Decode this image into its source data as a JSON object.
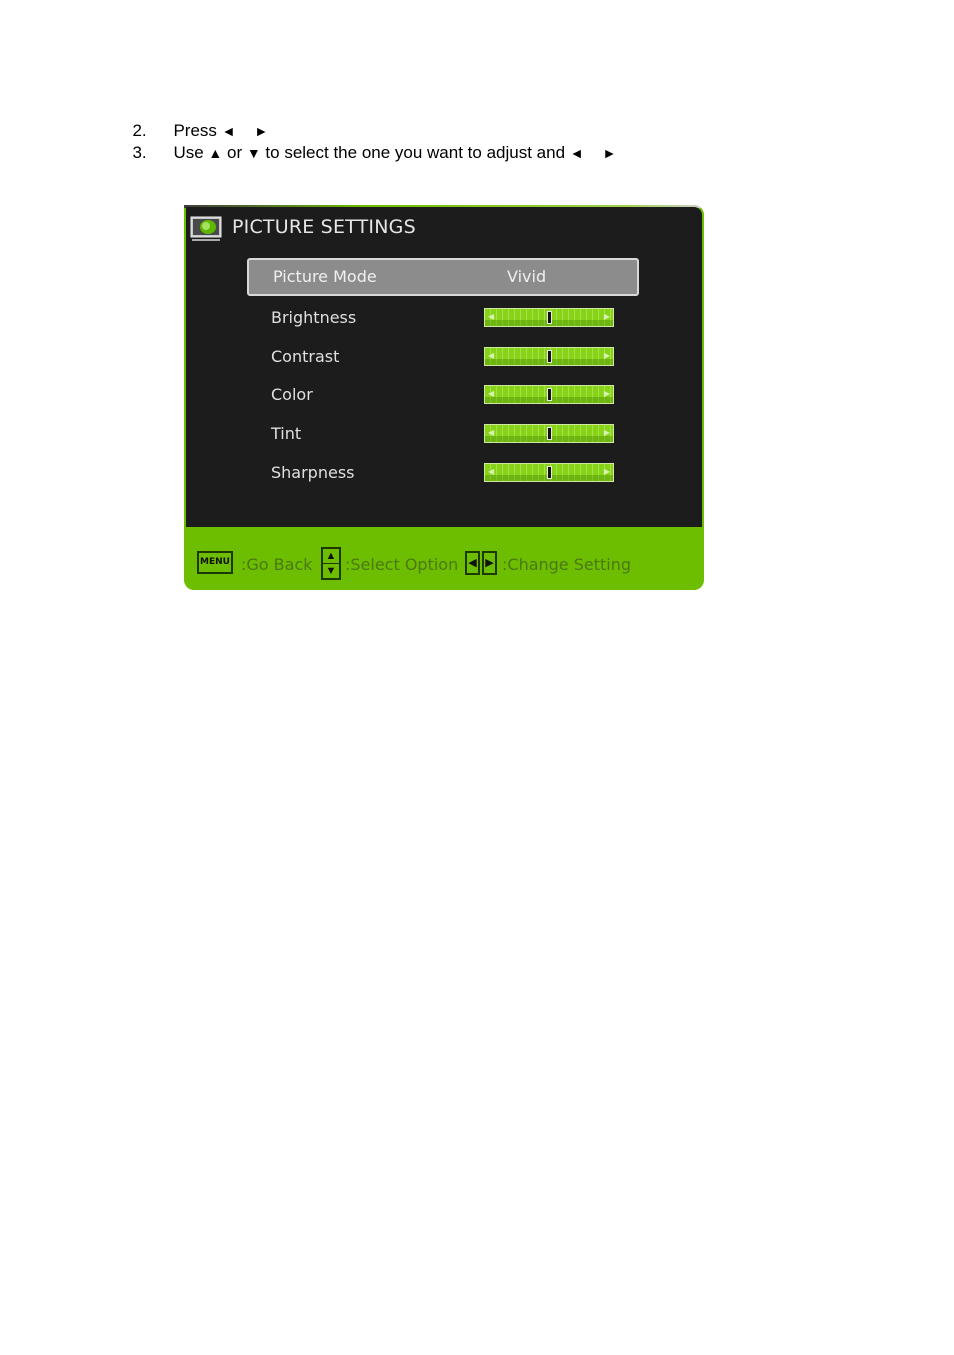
{
  "instructions": {
    "steps": [
      {
        "number": "2.",
        "text_before": "Press ",
        "arrow_left": "◄",
        "gap": "    ",
        "arrow_right": "►",
        "text_after": ""
      },
      {
        "number": "3.",
        "text_before": "Use ",
        "arrow_up": "▲",
        "mid1": " or ",
        "arrow_down": "▼",
        "mid2": " to select the one you want to adjust and ",
        "arrow_left": "◄",
        "gap": "    ",
        "arrow_right": "►"
      }
    ]
  },
  "osd": {
    "title": "PICTURE SETTINGS",
    "header_icon": "picture-settings-icon",
    "rows": [
      {
        "label": "Picture Mode",
        "value": "Vivid",
        "selected": true
      },
      {
        "label": "Brightness",
        "slider_percent": 50
      },
      {
        "label": "Contrast",
        "slider_percent": 50
      },
      {
        "label": "Color",
        "slider_percent": 50
      },
      {
        "label": "Tint",
        "slider_percent": 50
      },
      {
        "label": "Sharpness",
        "slider_percent": 50
      }
    ],
    "footer": {
      "menu_key": "MENU",
      "go_back": ":Go Back",
      "select_option": ":Select Option",
      "change_setting": ":Change Setting",
      "up_glyph": "▲",
      "down_glyph": "▼",
      "left_glyph": "◀",
      "right_glyph": "▶"
    },
    "colors": {
      "accent_green": "#6dbd00",
      "panel_bg": "#1c1c1c",
      "selected_bg": "#8c8c8c"
    }
  }
}
